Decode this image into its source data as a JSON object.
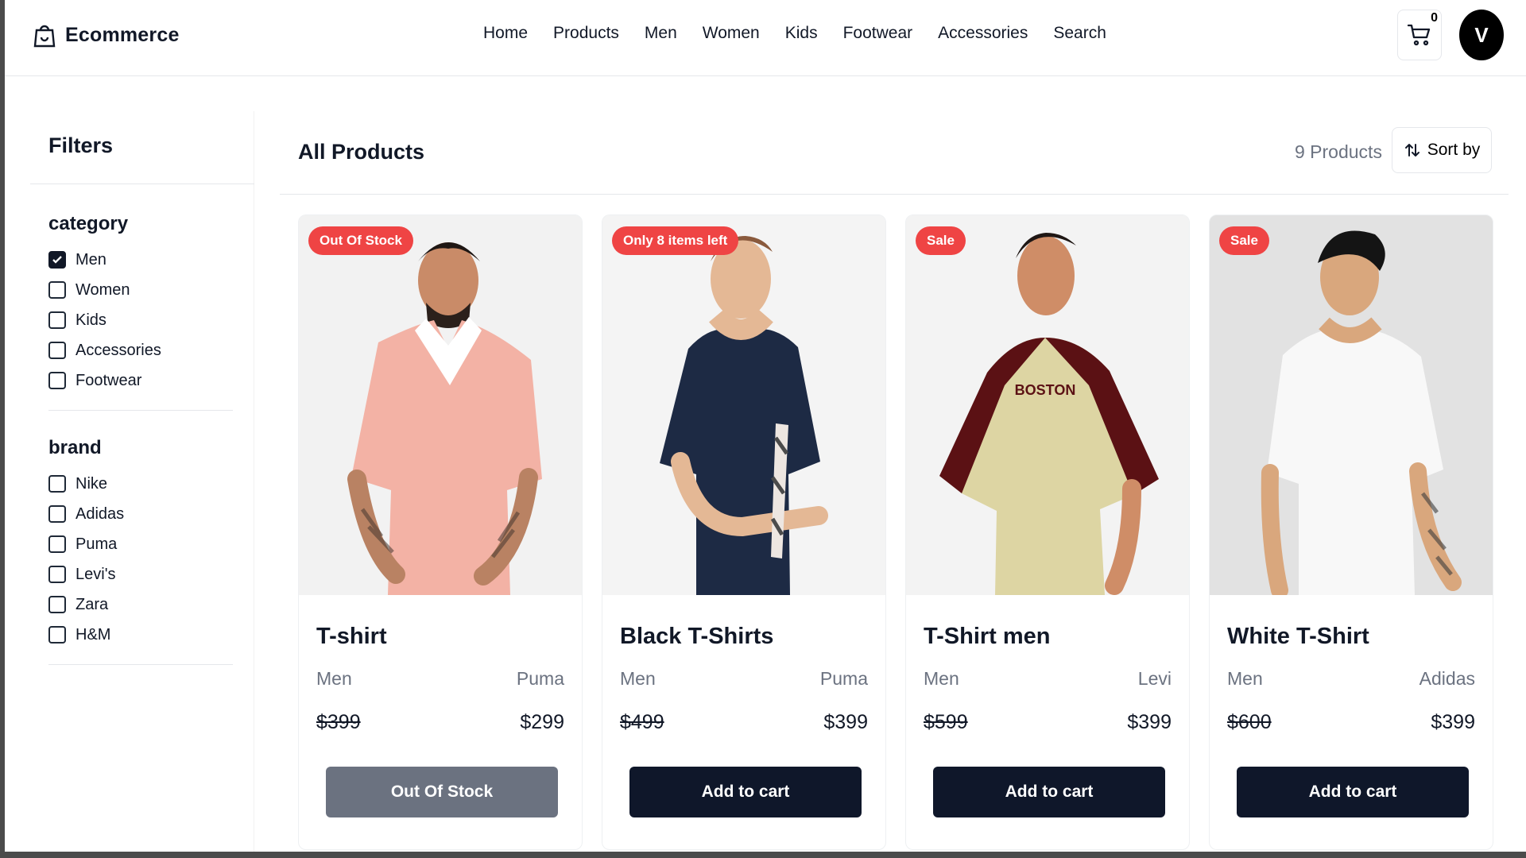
{
  "header": {
    "brand": "Ecommerce",
    "nav": [
      "Home",
      "Products",
      "Men",
      "Women",
      "Kids",
      "Footwear",
      "Accessories",
      "Search"
    ],
    "cart_count": "0",
    "avatar_initial": "V"
  },
  "sidebar": {
    "title": "Filters",
    "groups": [
      {
        "title": "category",
        "options": [
          {
            "label": "Men",
            "checked": true
          },
          {
            "label": "Women",
            "checked": false
          },
          {
            "label": "Kids",
            "checked": false
          },
          {
            "label": "Accessories",
            "checked": false
          },
          {
            "label": "Footwear",
            "checked": false
          }
        ]
      },
      {
        "title": "brand",
        "options": [
          {
            "label": "Nike",
            "checked": false
          },
          {
            "label": "Adidas",
            "checked": false
          },
          {
            "label": "Puma",
            "checked": false
          },
          {
            "label": "Levi's",
            "checked": false
          },
          {
            "label": "Zara",
            "checked": false
          },
          {
            "label": "H&M",
            "checked": false
          }
        ]
      }
    ]
  },
  "main": {
    "title": "All Products",
    "count": "9 Products",
    "sort_label": "Sort by",
    "products": [
      {
        "badge": "Out Of Stock",
        "title": "T-shirt",
        "category": "Men",
        "brand": "Puma",
        "old_price": "$399",
        "price": "$299",
        "button": "Out Of Stock",
        "shirt_color": "#f4b3a9",
        "disabled": true
      },
      {
        "badge": "Only 8 items left",
        "title": "Black T-Shirts",
        "category": "Men",
        "brand": "Puma",
        "old_price": "$499",
        "price": "$399",
        "button": "Add to cart",
        "shirt_color": "#1f2a44",
        "disabled": false
      },
      {
        "badge": "Sale",
        "title": "T-Shirt men",
        "category": "Men",
        "brand": "Levi",
        "old_price": "$599",
        "price": "$399",
        "button": "Add to cart",
        "shirt_color": "#ddd6a2",
        "disabled": false
      },
      {
        "badge": "Sale",
        "title": "White T-Shirt",
        "category": "Men",
        "brand": "Adidas",
        "old_price": "$600",
        "price": "$399",
        "button": "Add to cart",
        "shirt_color": "#f8f8f8",
        "disabled": false
      }
    ]
  }
}
